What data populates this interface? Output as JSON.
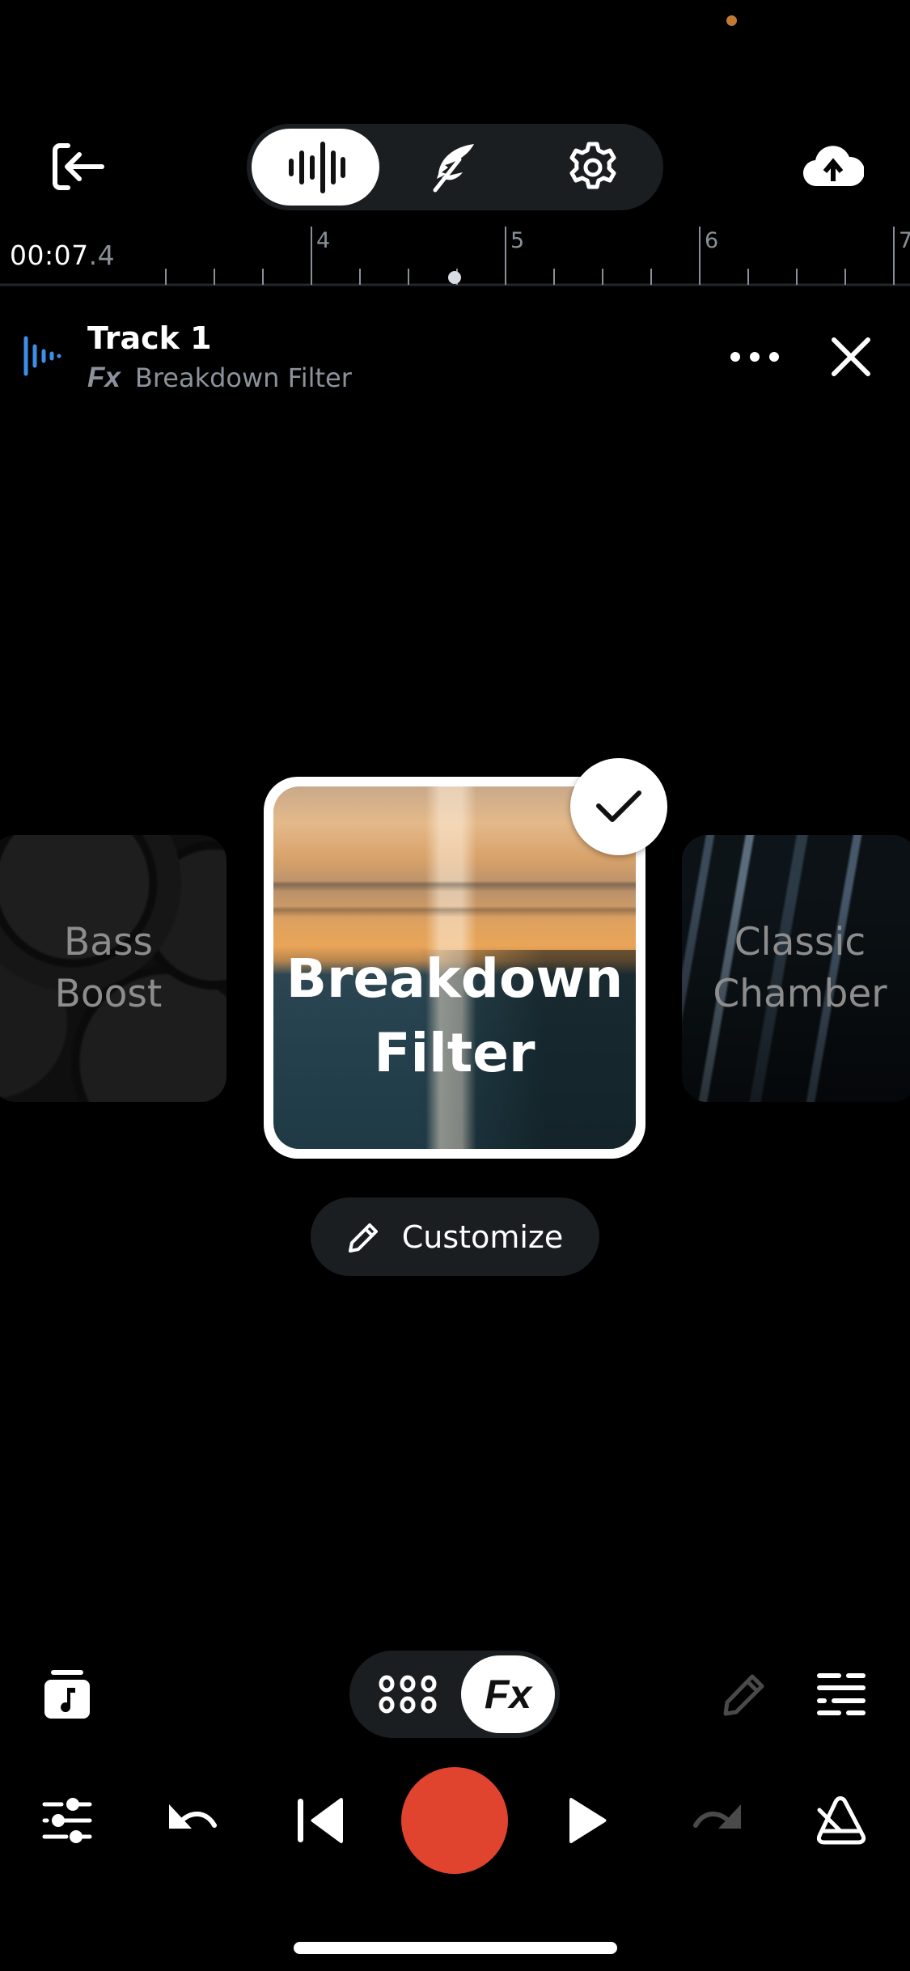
{
  "status_bar": {
    "indicator_color": "#c17a33"
  },
  "header": {
    "exit_icon": "exit-icon",
    "modes": [
      {
        "name": "waveform",
        "icon": "waveform-icon",
        "active": true
      },
      {
        "name": "feather",
        "icon": "feather-icon",
        "active": false
      },
      {
        "name": "settings",
        "icon": "gear-icon",
        "active": false
      }
    ],
    "upload_icon": "cloud-upload-icon"
  },
  "timeline": {
    "time_main": "00:07",
    "time_fraction": ".4",
    "ruler_labels": [
      "4",
      "5",
      "6",
      "7"
    ]
  },
  "track": {
    "title": "Track 1",
    "fx_tag": "Fx",
    "effect_name": "Breakdown Filter",
    "accent_color": "#3d8ee6"
  },
  "effects": {
    "items": [
      {
        "label_line1": "Bass",
        "label_line2": "Boost",
        "selected": false
      },
      {
        "label_line1": "Breakdown",
        "label_line2": "Filter",
        "selected": true
      },
      {
        "label_line1": "Classic",
        "label_line2": "Chamber",
        "selected": false
      }
    ],
    "customize_label": "Customize"
  },
  "bottom_toolbar": {
    "view_toggle": [
      {
        "name": "grid",
        "icon": "grid-icon",
        "active": false
      },
      {
        "name": "fx",
        "label": "Fx",
        "active": true
      }
    ]
  },
  "transport": {
    "record_color": "#e0432e",
    "redo_enabled": false,
    "edit_enabled": false
  }
}
